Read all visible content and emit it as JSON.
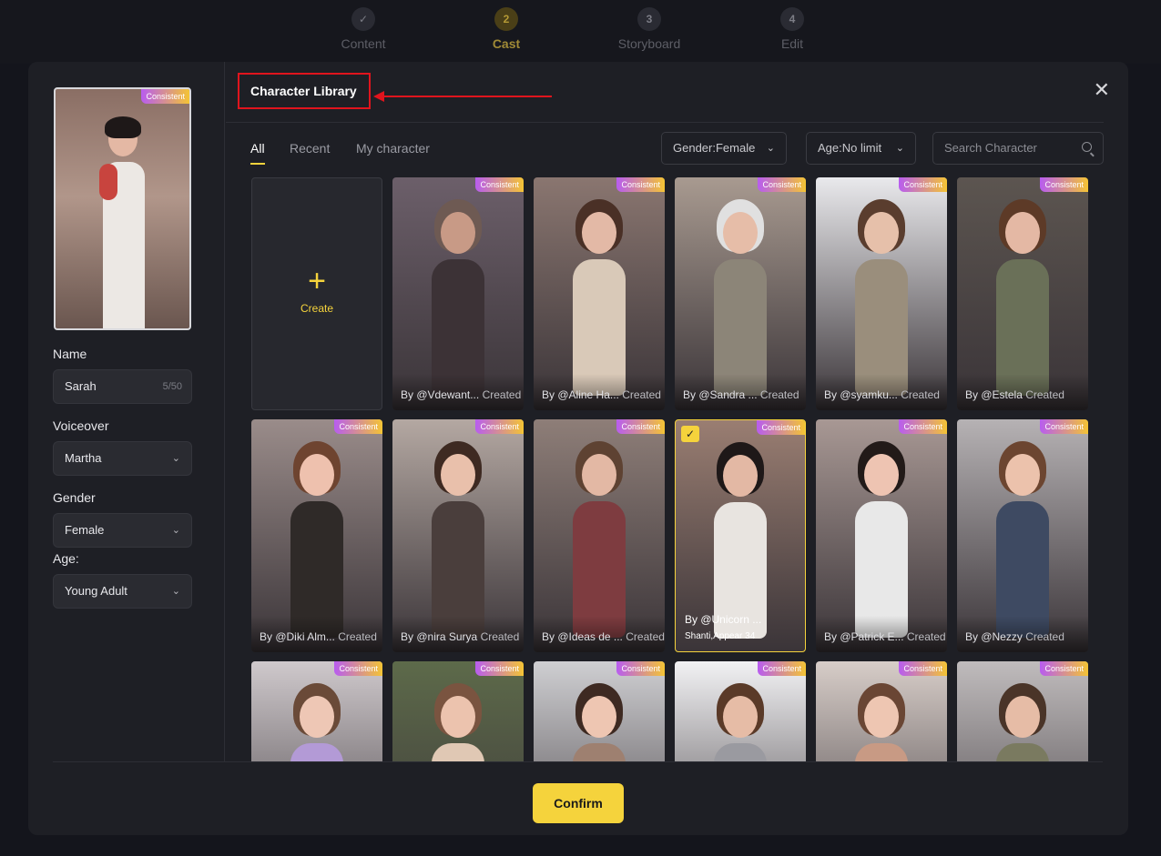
{
  "stepper": {
    "steps": [
      {
        "num": "✓",
        "label": "Content"
      },
      {
        "num": "2",
        "label": "Cast"
      },
      {
        "num": "3",
        "label": "Storyboard"
      },
      {
        "num": "4",
        "label": "Edit"
      }
    ]
  },
  "left_panel": {
    "preview_badge": "Consistent",
    "name_label": "Name",
    "name_value": "Sarah",
    "name_count": "5/50",
    "voiceover_label": "Voiceover",
    "voiceover_value": "Martha",
    "gender_label": "Gender",
    "gender_value": "Female",
    "age_label": "Age:",
    "age_value": "Young Adult"
  },
  "library": {
    "title": "Character Library",
    "tabs": [
      "All",
      "Recent",
      "My character"
    ],
    "gender_filter": "Gender:Female",
    "age_filter": "Age:No limit",
    "search_placeholder": "Search Character",
    "create_label": "Create",
    "badge": "Consistent",
    "created_word": "Created",
    "cards": [
      {
        "by": "By @Vdewant...",
        "bg": "#6c5f6a",
        "skin": "#c89a86",
        "hair": "#6e5a53",
        "cloth": "#3c3236"
      },
      {
        "by": "By @Aline Ha...",
        "bg": "#8a7670",
        "skin": "#e3b9a6",
        "hair": "#4a3026",
        "cloth": "#d9c9b8"
      },
      {
        "by": "By @Sandra ...",
        "bg": "#a89a90",
        "skin": "#e6bda8",
        "hair": "#e0e0e0",
        "cloth": "#8c8578"
      },
      {
        "by": "By @syamku...",
        "bg": "#e9e9ec",
        "skin": "#e6c0aa",
        "hair": "#5a3d2e",
        "cloth": "#9a8e7c"
      },
      {
        "by": "By @Estela",
        "bg": "#5c5550",
        "skin": "#e4b8a4",
        "hair": "#5d3a27",
        "cloth": "#6a7058"
      },
      {
        "by": "By @Diki Alm...",
        "bg": "#9a8c8a",
        "skin": "#eec1ae",
        "hair": "#6e4430",
        "cloth": "#2f2a28"
      },
      {
        "by": "By @nira Surya",
        "bg": "#b4a8a2",
        "skin": "#e9c0ab",
        "hair": "#3e2a22",
        "cloth": "#4a3e3c"
      },
      {
        "by": "By @Ideas de ...",
        "bg": "#8e7e78",
        "skin": "#e3b8a4",
        "hair": "#5e4232",
        "cloth": "#7e3c40"
      },
      {
        "by": "By @Unicorn ...",
        "bg": "#9a7e72",
        "skin": "#e3b8a4",
        "hair": "#1e1818",
        "cloth": "#e8e4e0",
        "selected": true,
        "sub": "Shanti,Appear 34"
      },
      {
        "by": "By @Patrick E...",
        "bg": "#a89894",
        "skin": "#eec4b2",
        "hair": "#221a18",
        "cloth": "#e8e8e8"
      },
      {
        "by": "By @Nezzy",
        "bg": "#b6b2b4",
        "skin": "#ecc2ac",
        "hair": "#6c4530",
        "cloth": "#3e4a62"
      },
      {
        "by": "",
        "bg": "#cfc9cc",
        "skin": "#eec7b5",
        "hair": "#6a4a38",
        "cloth": "#b39ad6"
      },
      {
        "by": "",
        "bg": "#5d6a4a",
        "skin": "#ecc3ae",
        "hair": "#7a5440",
        "cloth": "#e0c8b4"
      },
      {
        "by": "",
        "bg": "#cfcfd2",
        "skin": "#eec6b2",
        "hair": "#3e2a22",
        "cloth": "#9e8070"
      },
      {
        "by": "",
        "bg": "#f2f2f4",
        "skin": "#e6bca6",
        "hair": "#5a3a28",
        "cloth": "#9a9aa0"
      },
      {
        "by": "",
        "bg": "#d7cdc8",
        "skin": "#eec6b2",
        "hair": "#6a4634",
        "cloth": "#c89a84"
      },
      {
        "by": "",
        "bg": "#c0bcbd",
        "skin": "#e6bca6",
        "hair": "#4a3428",
        "cloth": "#7a7a60"
      }
    ]
  },
  "footer": {
    "confirm_label": "Confirm"
  }
}
